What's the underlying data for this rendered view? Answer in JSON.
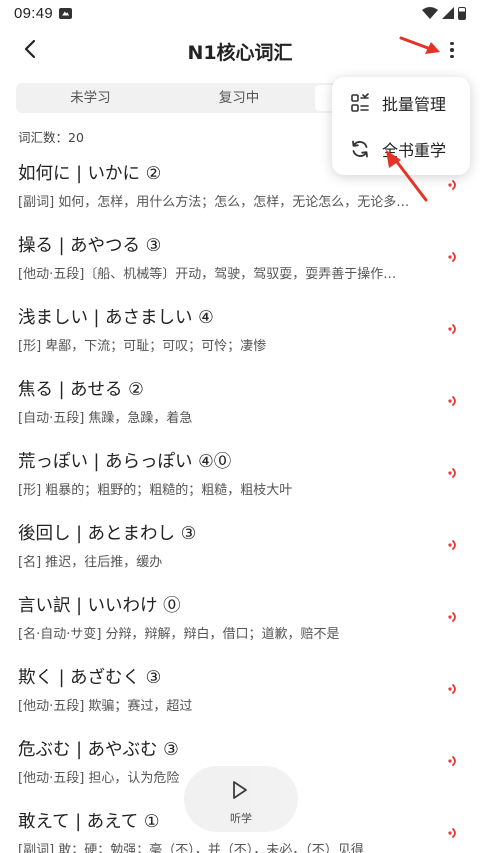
{
  "status_bar": {
    "time": "09:49"
  },
  "header": {
    "title": "N1核心词汇"
  },
  "tabs": [
    {
      "label": "未学习"
    },
    {
      "label": "复习中"
    },
    {
      "label": ""
    }
  ],
  "word_count": "词汇数：20",
  "words": [
    {
      "title": "如何に | いかに ②",
      "meaning": "[副词] 如何，怎样，用什么方法；怎么，怎样，无论怎么，无论多…"
    },
    {
      "title": "操る | あやつる ③",
      "meaning": "[他动·五段]〔船、机械等〕开动，驾驶，驾驭耍，耍弄善于操作…"
    },
    {
      "title": "浅ましい | あさましい ④",
      "meaning": "[形] 卑鄙，下流；可耻；可叹；可怜；凄惨"
    },
    {
      "title": "焦る | あせる ②",
      "meaning": "[自动·五段] 焦躁，急躁，着急"
    },
    {
      "title": "荒っぽい | あらっぽい ④⓪",
      "meaning": "[形] 粗暴的；粗野的；粗糙的；粗糙，粗枝大叶"
    },
    {
      "title": "後回し | あとまわし ③",
      "meaning": "[名] 推迟，往后推，缓办"
    },
    {
      "title": "言い訳 | いいわけ ⓪",
      "meaning": "[名·自动·サ变] 分辩，辩解，辩白，借口；道歉，赔不是"
    },
    {
      "title": "欺く | あざむく ③",
      "meaning": "[他动·五段] 欺骗；赛过，超过"
    },
    {
      "title": "危ぶむ | あやぶむ ③",
      "meaning": "[他动·五段] 担心，认为危险"
    },
    {
      "title": "敢えて | あえて ①",
      "meaning": "[副词] 敢；硬；勉强；毫（不），并（不），未必，（不）见得"
    }
  ],
  "menu": {
    "items": [
      {
        "label": "批量管理",
        "icon": "batch-manage-icon"
      },
      {
        "label": "全书重学",
        "icon": "refresh-icon"
      }
    ]
  },
  "listen_button": {
    "label": "听学",
    "icon": "play-icon"
  },
  "colors": {
    "accent_red": "#e53935",
    "arrow_red": "#e53227",
    "tab_bg": "#f1f1f1"
  }
}
